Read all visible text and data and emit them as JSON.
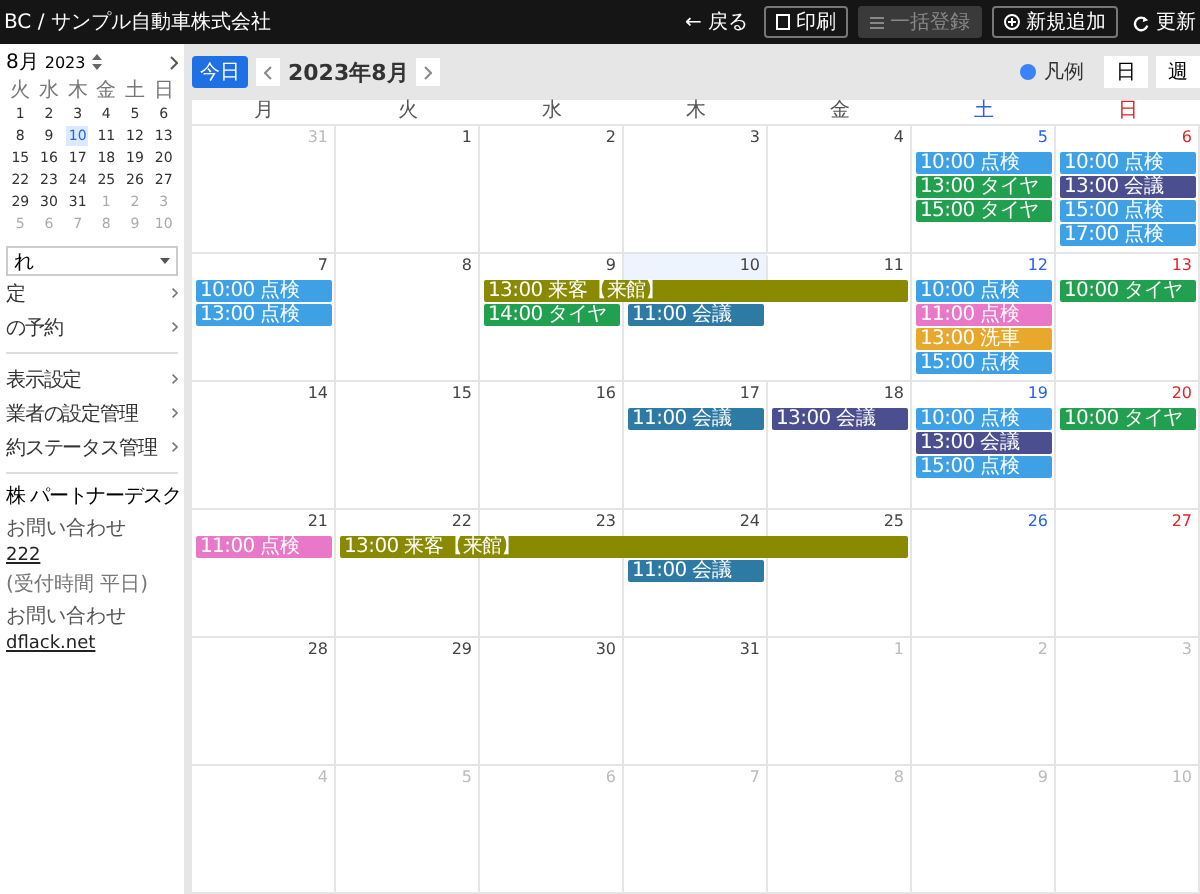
{
  "topbar": {
    "title": "BC / サンプル自動車株式会社",
    "back": "← 戻る",
    "buttons": [
      {
        "label": "印刷",
        "kind": "print",
        "disabled": false
      },
      {
        "label": "一括登録",
        "kind": "bulk",
        "disabled": true
      },
      {
        "label": "新規追加",
        "kind": "add",
        "disabled": false
      },
      {
        "label": "更新",
        "kind": "refresh",
        "disabled": false
      }
    ]
  },
  "sidebar": {
    "mini_calendar": {
      "month": "8月",
      "year": "2023",
      "weekdays": [
        "火",
        "水",
        "木",
        "金",
        "土",
        "日"
      ],
      "weeks": [
        [
          {
            "d": "1",
            "other": false,
            "selected": false
          },
          {
            "d": "2",
            "other": false,
            "selected": false
          },
          {
            "d": "3",
            "other": false,
            "selected": false
          },
          {
            "d": "4",
            "other": false,
            "selected": false
          },
          {
            "d": "5",
            "other": false,
            "selected": false
          },
          {
            "d": "6",
            "other": false,
            "selected": false
          }
        ],
        [
          {
            "d": "8",
            "other": false,
            "selected": false
          },
          {
            "d": "9",
            "other": false,
            "selected": false
          },
          {
            "d": "10",
            "other": false,
            "selected": true
          },
          {
            "d": "11",
            "other": false,
            "selected": false
          },
          {
            "d": "12",
            "other": false,
            "selected": false
          },
          {
            "d": "13",
            "other": false,
            "selected": false
          }
        ],
        [
          {
            "d": "15",
            "other": false,
            "selected": false
          },
          {
            "d": "16",
            "other": false,
            "selected": false
          },
          {
            "d": "17",
            "other": false,
            "selected": false
          },
          {
            "d": "18",
            "other": false,
            "selected": false
          },
          {
            "d": "19",
            "other": false,
            "selected": false
          },
          {
            "d": "20",
            "other": false,
            "selected": false
          }
        ],
        [
          {
            "d": "22",
            "other": false,
            "selected": false
          },
          {
            "d": "23",
            "other": false,
            "selected": false
          },
          {
            "d": "24",
            "other": false,
            "selected": false
          },
          {
            "d": "25",
            "other": false,
            "selected": false
          },
          {
            "d": "26",
            "other": false,
            "selected": false
          },
          {
            "d": "27",
            "other": false,
            "selected": false
          }
        ],
        [
          {
            "d": "29",
            "other": false,
            "selected": false
          },
          {
            "d": "30",
            "other": false,
            "selected": false
          },
          {
            "d": "31",
            "other": false,
            "selected": false
          },
          {
            "d": "1",
            "other": true,
            "selected": false
          },
          {
            "d": "2",
            "other": true,
            "selected": false
          },
          {
            "d": "3",
            "other": true,
            "selected": false
          }
        ],
        [
          {
            "d": "5",
            "other": true,
            "selected": false
          },
          {
            "d": "6",
            "other": true,
            "selected": false
          },
          {
            "d": "7",
            "other": true,
            "selected": false
          },
          {
            "d": "8",
            "other": true,
            "selected": false
          },
          {
            "d": "9",
            "other": true,
            "selected": false
          },
          {
            "d": "10",
            "other": true,
            "selected": false
          }
        ]
      ]
    },
    "select": {
      "value": "れ"
    },
    "menu": [
      [
        "定",
        "の予約"
      ],
      [
        "表示設定",
        "業者の設定管理",
        "約ステータス管理"
      ]
    ],
    "footer": {
      "title": "株 パートナーデスク",
      "contacts": [
        {
          "label": "お問い合わせ",
          "value": "222",
          "note": "(受付時間 平日)"
        },
        {
          "label": "お問い合わせ",
          "value": "dflack.net"
        }
      ]
    }
  },
  "toolbar": {
    "today": "今日",
    "month": "2023年8月",
    "legend": "凡例",
    "views": [
      {
        "label": "日",
        "selected": false
      },
      {
        "label": "週",
        "selected": false
      }
    ]
  },
  "calendar": {
    "weekdays": [
      {
        "label": "月",
        "kind": "weekday"
      },
      {
        "label": "火",
        "kind": "weekday"
      },
      {
        "label": "水",
        "kind": "weekday"
      },
      {
        "label": "木",
        "kind": "weekday"
      },
      {
        "label": "金",
        "kind": "weekday"
      },
      {
        "label": "土",
        "kind": "saturday"
      },
      {
        "label": "日",
        "kind": "sunday"
      }
    ],
    "weeks": [
      [
        {
          "date": "31",
          "other": true,
          "today": false
        },
        {
          "date": "1",
          "other": false,
          "today": false
        },
        {
          "date": "2",
          "other": false,
          "today": false
        },
        {
          "date": "3",
          "other": false,
          "today": false
        },
        {
          "date": "4",
          "other": false,
          "today": false
        },
        {
          "date": "5",
          "other": false,
          "today": false,
          "events": [
            {
              "text": "10:00 点検",
              "color": "#3ea1e6"
            },
            {
              "text": "13:00 タイヤ",
              "color": "#21a04f"
            },
            {
              "text": "15:00 タイヤ",
              "color": "#21a04f"
            }
          ]
        },
        {
          "date": "6",
          "other": false,
          "today": false,
          "events": [
            {
              "text": "10:00 点検",
              "color": "#3ea1e6"
            },
            {
              "text": "13:00 会議",
              "color": "#4b4f8f"
            },
            {
              "text": "15:00 点検",
              "color": "#3ea1e6"
            },
            {
              "text": "17:00 点検",
              "color": "#3ea1e6"
            }
          ]
        }
      ],
      [
        {
          "date": "7",
          "other": false,
          "today": false,
          "events": [
            {
              "text": "10:00 点検",
              "color": "#3ea1e6"
            },
            {
              "text": "13:00 点検",
              "color": "#3ea1e6"
            }
          ]
        },
        {
          "date": "8",
          "other": false,
          "today": false
        },
        {
          "date": "9",
          "other": false,
          "today": false,
          "events": [
            {
              "kind": "start",
              "text": "13:00 来客【来館】",
              "color": "#8a8a00"
            },
            {
              "kind": "start",
              "text": "14:00 タイヤ",
              "color": "#21a04f"
            }
          ]
        },
        {
          "date": "10",
          "other": false,
          "today": true,
          "events": [
            {
              "kind": "continuation",
              "color": "#8a8a00"
            },
            {
              "kind": "start",
              "text": "11:00 会議",
              "color": "#2d7aa5"
            }
          ]
        },
        {
          "date": "11",
          "other": false,
          "today": false,
          "events": [
            {
              "kind": "continuation",
              "color": "#8a8a00"
            }
          ]
        },
        {
          "date": "12",
          "other": false,
          "today": false,
          "events": [
            {
              "text": "10:00 点検",
              "color": "#3ea1e6"
            },
            {
              "text": "11:00 点検",
              "color": "#ea78c8"
            },
            {
              "text": "13:00 洗車",
              "color": "#e8a82b"
            },
            {
              "text": "15:00 点検",
              "color": "#3ea1e6"
            }
          ]
        },
        {
          "date": "13",
          "other": false,
          "today": false,
          "events": [
            {
              "text": "10:00 タイヤ",
              "color": "#21a04f"
            }
          ]
        }
      ],
      [
        {
          "date": "14",
          "other": false,
          "today": false
        },
        {
          "date": "15",
          "other": false,
          "today": false
        },
        {
          "date": "16",
          "other": false,
          "today": false
        },
        {
          "date": "17",
          "other": false,
          "today": false,
          "events": [
            {
              "text": "11:00 会議",
              "color": "#2d7aa5"
            }
          ]
        },
        {
          "date": "18",
          "other": false,
          "today": false,
          "events": [
            {
              "text": "13:00 会議",
              "color": "#4b4f8f"
            }
          ]
        },
        {
          "date": "19",
          "other": false,
          "today": false,
          "events": [
            {
              "text": "10:00 点検",
              "color": "#3ea1e6"
            },
            {
              "text": "13:00 会議",
              "color": "#4b4f8f"
            },
            {
              "text": "15:00 点検",
              "color": "#3ea1e6"
            }
          ]
        },
        {
          "date": "20",
          "other": false,
          "today": false,
          "events": [
            {
              "text": "10:00 タイヤ",
              "color": "#21a04f"
            }
          ]
        }
      ],
      [
        {
          "date": "21",
          "other": false,
          "today": false,
          "events": [
            {
              "text": "11:00 点検",
              "color": "#ea78c8"
            }
          ]
        },
        {
          "date": "22",
          "other": false,
          "today": false,
          "events": [
            {
              "kind": "start",
              "text": "13:00 来客【来館】",
              "color": "#8a8a00"
            }
          ]
        },
        {
          "date": "23",
          "other": false,
          "today": false,
          "events": [
            {
              "kind": "continuation",
              "color": "#8a8a00"
            }
          ]
        },
        {
          "date": "24",
          "other": false,
          "today": false,
          "events": [
            {
              "kind": "continuation",
              "color": "#8a8a00"
            },
            {
              "kind": "start",
              "text": "11:00 会議",
              "color": "#2d7aa5"
            }
          ]
        },
        {
          "date": "25",
          "other": false,
          "today": false,
          "events": [
            {
              "kind": "continuation",
              "color": "#8a8a00"
            }
          ]
        },
        {
          "date": "26",
          "other": false,
          "today": false
        },
        {
          "date": "27",
          "other": false,
          "today": false
        }
      ],
      [
        {
          "date": "28",
          "other": false,
          "today": false
        },
        {
          "date": "29",
          "other": false,
          "today": false
        },
        {
          "date": "30",
          "other": false,
          "today": false
        },
        {
          "date": "31",
          "other": false,
          "today": false
        },
        {
          "date": "1",
          "other": true,
          "today": false
        },
        {
          "date": "2",
          "other": true,
          "today": false
        },
        {
          "date": "3",
          "other": true,
          "today": false
        }
      ],
      [
        {
          "date": "4",
          "other": true,
          "today": false
        },
        {
          "date": "5",
          "other": true,
          "today": false
        },
        {
          "date": "6",
          "other": true,
          "today": false
        },
        {
          "date": "7",
          "other": true,
          "today": false
        },
        {
          "date": "8",
          "other": true,
          "today": false
        },
        {
          "date": "9",
          "other": true,
          "today": false
        },
        {
          "date": "10",
          "other": true,
          "today": false
        }
      ]
    ]
  }
}
